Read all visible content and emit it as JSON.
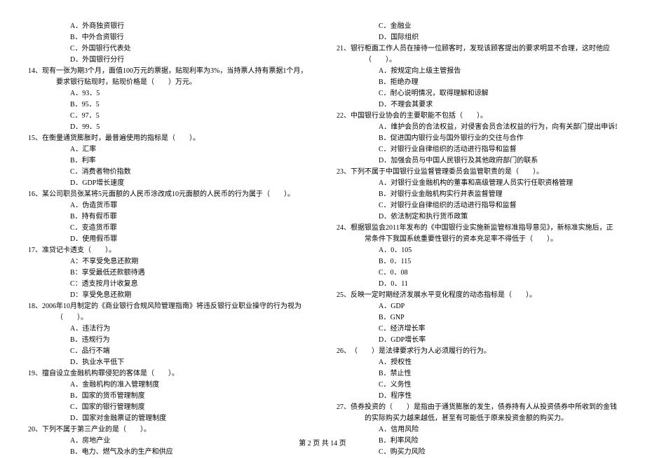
{
  "left": {
    "q13opts": [
      "A．外商独资银行",
      "B．中外合资银行",
      "C．外国银行代表处",
      "D．外国银行分行"
    ],
    "q14": {
      "num": "14、",
      "txt": "现有一张为期3个月，面值100万元的票据，贴现利率为3%，当持票人持有票据1个月，要求银行贴现时，贴现价格是（　　）万元。"
    },
    "q14opts": [
      "A．93．5",
      "B．95．5",
      "C．97．5",
      "D．99．5"
    ],
    "q15": {
      "num": "15、",
      "txt": "在衡量通货膨胀时，最普遍使用的指标是（　　）。"
    },
    "q15opts": [
      "A．汇率",
      "B．利率",
      "C．消费者物价指数",
      "D．GDP增长速度"
    ],
    "q16": {
      "num": "16、",
      "txt": "某公司职员张某将5元面额的人民币涂改成10元面额的人民币的行为属于（　　）。"
    },
    "q16opts": [
      "A．伪造货币罪",
      "B．持有假币罪",
      "C．变造货币罪",
      "D．使用假币罪"
    ],
    "q17": {
      "num": "17、",
      "txt": "准贷记卡透支（　　）。"
    },
    "q17opts": [
      "A：不享受免息还款期",
      "B：享受最低还款额待遇",
      "C：透支按月计收复息",
      "D：享受免息还款期"
    ],
    "q18": {
      "num": "18、",
      "txt": "2006年10月制定的《商业银行合规风险管理指南》将违反银行业职业操守的行为视为（　　）。"
    },
    "q18opts": [
      "A．违法行为",
      "B．违规行为",
      "C．品行不端",
      "D．执业水平低下"
    ],
    "q19": {
      "num": "19、",
      "txt": "擅自设立金融机构罪侵犯的客体是（　　）。"
    },
    "q19opts": [
      "A．金融机构的准入管理制度",
      "B．国家的货币管理制度",
      "C．国家的银行管理制度",
      "D．国家对金融票证的管理制度"
    ],
    "q20": {
      "num": "20、",
      "txt": "下列不属于第三产业的是（　　）。"
    },
    "q20opts": [
      "A．房地产业",
      "B．电力、燃气及水的生产和供应"
    ]
  },
  "right": {
    "q20opts2": [
      "C．金融业",
      "D．国际组织"
    ],
    "q21": {
      "num": "21、",
      "txt": "银行柜面工作人员在接待一位顾客时，发现该顾客提出的要求明显不合理，这时他应（　　）。"
    },
    "q21opts": [
      "A．按规定向上级主管报告",
      "B．拒绝办理",
      "C．耐心说明情况，取得理解和谅解",
      "D．不理会其要求"
    ],
    "q22": {
      "num": "22、",
      "txt": "中国银行业协会的主要职能不包括（　　）。"
    },
    "q22opts": [
      "A．维护会员的合法权益，对侵害会员合法权益的行为，向有关部门提出申诉或要求",
      "B．促进国内银行业与国外银行业的交往与合作",
      "C．对银行业自律组织的活动进行指导和监督",
      "D．加强会员与中国人民银行及其他政府部门的联系"
    ],
    "q23": {
      "num": "23、",
      "txt": "下列不属于中国银行业监督管理委员会监管职责的是（　　）。"
    },
    "q23opts": [
      "A．对银行业金融机构的董事和高级管理人员实行任职资格管理",
      "B．对银行业金融机构实行并表监督管理",
      "C．对银行业自律组织的活动进行指导和监督",
      "D．依法制定和执行货币政策"
    ],
    "q24": {
      "num": "24、",
      "txt": "根据银监会2011年发布的《中国银行业实施新监管标准指导意见》，新标准实施后，正常条件下我国系统重要性银行的资本充足率不得低于（　　）。"
    },
    "q24opts": [
      "A．0．105",
      "B．0．115",
      "C．0．08",
      "D．0．11"
    ],
    "q25": {
      "num": "25、",
      "txt": "反映一定时期经济发展水平变化程度的动态指标是（　　）。"
    },
    "q25opts": [
      "A．GDP",
      "B．GNP",
      "C．经济增长率",
      "D．GDP增长率"
    ],
    "q26": {
      "num": "26、",
      "txt": "（　　）是法律要求行为人必须履行的行为。"
    },
    "q26opts": [
      "A．授权性",
      "B．禁止性",
      "C．义务性",
      "D．程序性"
    ],
    "q27": {
      "num": "27、",
      "txt": "债券投资的（　　）是指由于通货膨胀的发生，债券持有人从投资债券中所收到的金钱的实际购买力越来越低，甚至有可能低于原来投资金额的购买力。"
    },
    "q27opts": [
      "A．信用风险",
      "B．利率风险",
      "C．购买力风险"
    ]
  },
  "footer": "第 2 页 共 14 页"
}
